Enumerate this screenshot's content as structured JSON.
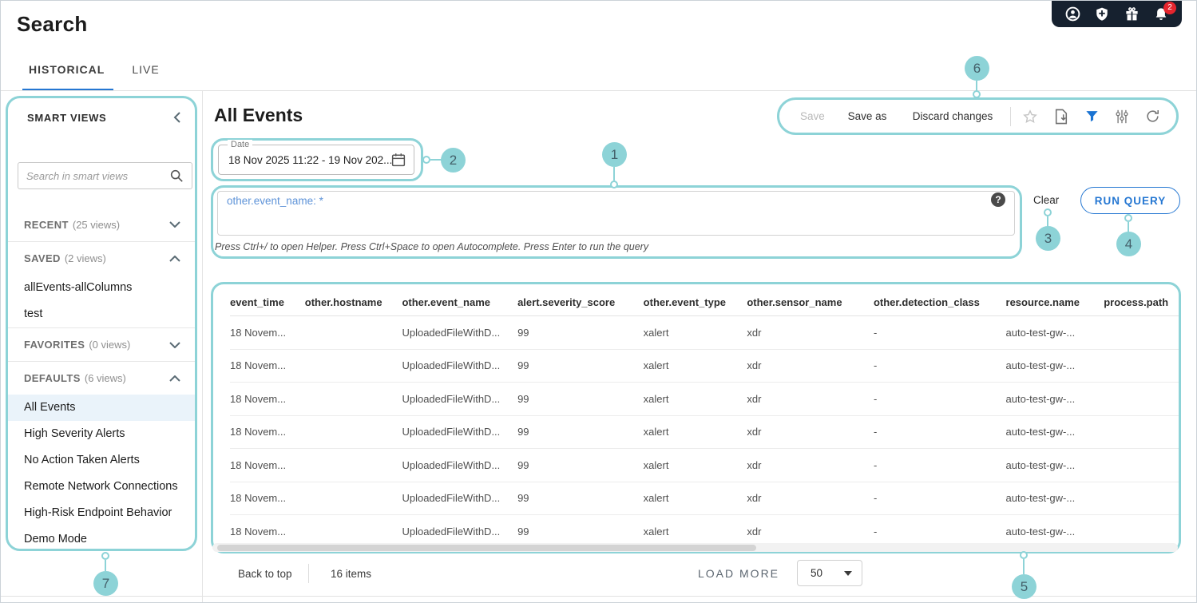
{
  "page": {
    "title": "Search"
  },
  "topbar": {
    "notification_count": "2"
  },
  "tabs": {
    "historical": "HISTORICAL",
    "live": "LIVE"
  },
  "sidebar": {
    "title": "SMART VIEWS",
    "search_placeholder": "Search in smart views",
    "sections": [
      {
        "label": "RECENT",
        "count": "(25 views)",
        "chevron": "down",
        "items": []
      },
      {
        "label": "SAVED",
        "count": "(2 views)",
        "chevron": "up",
        "items": [
          {
            "label": "allEvents-allColumns"
          },
          {
            "label": "test"
          }
        ]
      },
      {
        "label": "FAVORITES",
        "count": "(0 views)",
        "chevron": "down",
        "items": []
      },
      {
        "label": "DEFAULTS",
        "count": "(6 views)",
        "chevron": "up",
        "items": [
          {
            "label": "All Events",
            "selected": true
          },
          {
            "label": "High Severity Alerts"
          },
          {
            "label": "No Action Taken Alerts"
          },
          {
            "label": "Remote Network Connections"
          },
          {
            "label": "High-Risk Endpoint Behavior"
          },
          {
            "label": "Demo Mode"
          }
        ]
      }
    ]
  },
  "main": {
    "title": "All Events",
    "toolbar": {
      "save": "Save",
      "save_as": "Save as",
      "discard": "Discard changes"
    },
    "date": {
      "label": "Date",
      "value": "18 Nov 2025 11:22 - 19 Nov 202..."
    },
    "query": {
      "text": "other.event_name: *",
      "help_glyph": "?",
      "hint": "Press Ctrl+/ to open Helper. Press Ctrl+Space to open Autocomplete. Press Enter to run the query",
      "clear_label": "Clear",
      "run_label": "RUN QUERY"
    },
    "table": {
      "columns": [
        "event_time",
        "other.hostname",
        "other.event_name",
        "alert.severity_score",
        "other.event_type",
        "other.sensor_name",
        "other.detection_class",
        "resource.name",
        "process.path"
      ],
      "rows": [
        [
          "18 Novem...",
          "",
          "UploadedFileWithD...",
          "99",
          "xalert",
          "xdr",
          "-",
          "auto-test-gw-...",
          ""
        ],
        [
          "18 Novem...",
          "",
          "UploadedFileWithD...",
          "99",
          "xalert",
          "xdr",
          "-",
          "auto-test-gw-...",
          ""
        ],
        [
          "18 Novem...",
          "",
          "UploadedFileWithD...",
          "99",
          "xalert",
          "xdr",
          "-",
          "auto-test-gw-...",
          ""
        ],
        [
          "18 Novem...",
          "",
          "UploadedFileWithD...",
          "99",
          "xalert",
          "xdr",
          "-",
          "auto-test-gw-...",
          ""
        ],
        [
          "18 Novem...",
          "",
          "UploadedFileWithD...",
          "99",
          "xalert",
          "xdr",
          "-",
          "auto-test-gw-...",
          ""
        ],
        [
          "18 Novem...",
          "",
          "UploadedFileWithD...",
          "99",
          "xalert",
          "xdr",
          "-",
          "auto-test-gw-...",
          ""
        ],
        [
          "18 Novem...",
          "",
          "UploadedFileWithD...",
          "99",
          "xalert",
          "xdr",
          "-",
          "auto-test-gw-...",
          ""
        ]
      ]
    },
    "footer": {
      "back_to_top": "Back to top",
      "items_count": "16 items",
      "load_more": "LOAD MORE",
      "page_size": "50"
    }
  },
  "annotations": [
    "1",
    "2",
    "3",
    "4",
    "5",
    "6",
    "7"
  ],
  "colors": {
    "accent_teal": "#8dd3d7",
    "accent_blue": "#2577d2",
    "badge_red": "#e4252e",
    "topbar_dark": "#16212f"
  }
}
